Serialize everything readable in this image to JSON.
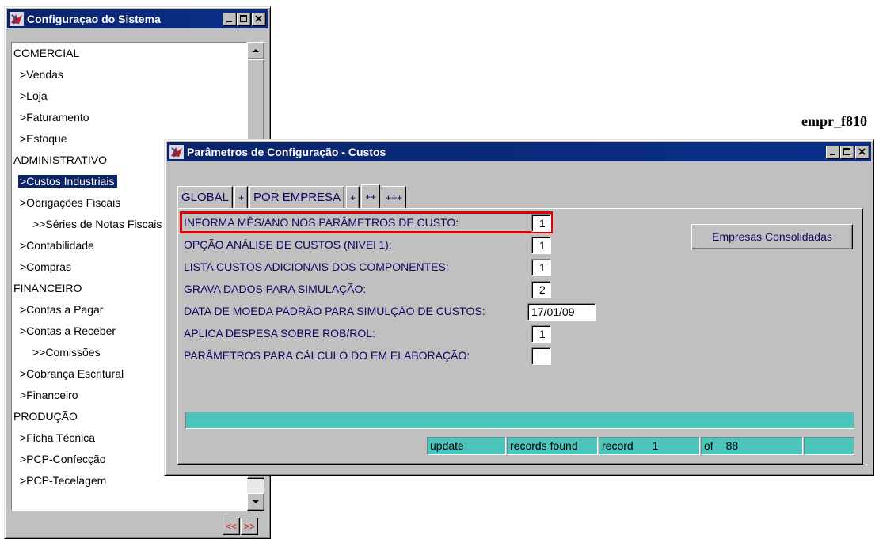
{
  "left_window": {
    "title": "Configuraçao do Sistema",
    "items": [
      {
        "label": "COMERCIAL",
        "level": 0
      },
      {
        "label": ">Vendas",
        "level": 1
      },
      {
        "label": ">Loja",
        "level": 1
      },
      {
        "label": ">Faturamento",
        "level": 1
      },
      {
        "label": ">Estoque",
        "level": 1
      },
      {
        "label": "ADMINISTRATIVO",
        "level": 0
      },
      {
        "label": ">Custos Industriais",
        "level": 1,
        "selected": true
      },
      {
        "label": ">Obrigações Fiscais",
        "level": 1
      },
      {
        "label": ">>Séries de Notas Fiscais",
        "level": 2
      },
      {
        "label": ">Contabilidade",
        "level": 1
      },
      {
        "label": ">Compras",
        "level": 1
      },
      {
        "label": "FINANCEIRO",
        "level": 0
      },
      {
        "label": ">Contas a Pagar",
        "level": 1
      },
      {
        "label": ">Contas a Receber",
        "level": 1
      },
      {
        "label": ">>Comissões",
        "level": 2
      },
      {
        "label": ">Cobrança Escritural",
        "level": 1
      },
      {
        "label": ">Financeiro",
        "level": 1
      },
      {
        "label": "PRODUÇÃO",
        "level": 0
      },
      {
        "label": ">Ficha Técnica",
        "level": 1
      },
      {
        "label": ">PCP-Confecção",
        "level": 1
      },
      {
        "label": ">PCP-Tecelagem",
        "level": 1
      }
    ],
    "nav_prev": "<<",
    "nav_next": ">>"
  },
  "form_name": "empr_f810",
  "main_window": {
    "title": "Parâmetros de Configuração - Custos",
    "tabs": [
      "GLOBAL",
      "+",
      "POR EMPRESA",
      "+",
      "++",
      "+++"
    ],
    "active_tab": 4,
    "rows": [
      {
        "label": "INFORMA MÊS/ANO NOS PARÂMETROS DE CUSTO:",
        "value": "1"
      },
      {
        "label": "OPÇÃO ANÁLISE DE CUSTOS (NIVEl 1):",
        "value": "1"
      },
      {
        "label": "LISTA CUSTOS ADICIONAIS DOS COMPONENTES:",
        "value": "1"
      },
      {
        "label": "GRAVA DADOS PARA SIMULAÇÃO:",
        "value": "2"
      },
      {
        "label": "DATA DE MOEDA PADRÃO PARA SIMULÇÃO DE CUSTOS:",
        "value": "17/01/09"
      },
      {
        "label": "APLICA DESPESA SOBRE ROB/ROL:",
        "value": "1"
      },
      {
        "label": "PARÂMETROS PARA CÁLCULO DO EM ELABORAÇÃO:",
        "value": ""
      }
    ],
    "button_label": "Empresas Consolidadas",
    "status": {
      "mode": "update",
      "found": "records found",
      "record_label": "record",
      "record_number": "1",
      "of_label": "of",
      "total": "88"
    }
  },
  "colors": {
    "titlebar": "#0a246a",
    "status_bg": "#4cc6bc",
    "highlight": "#e00000",
    "label_text": "#180060"
  }
}
